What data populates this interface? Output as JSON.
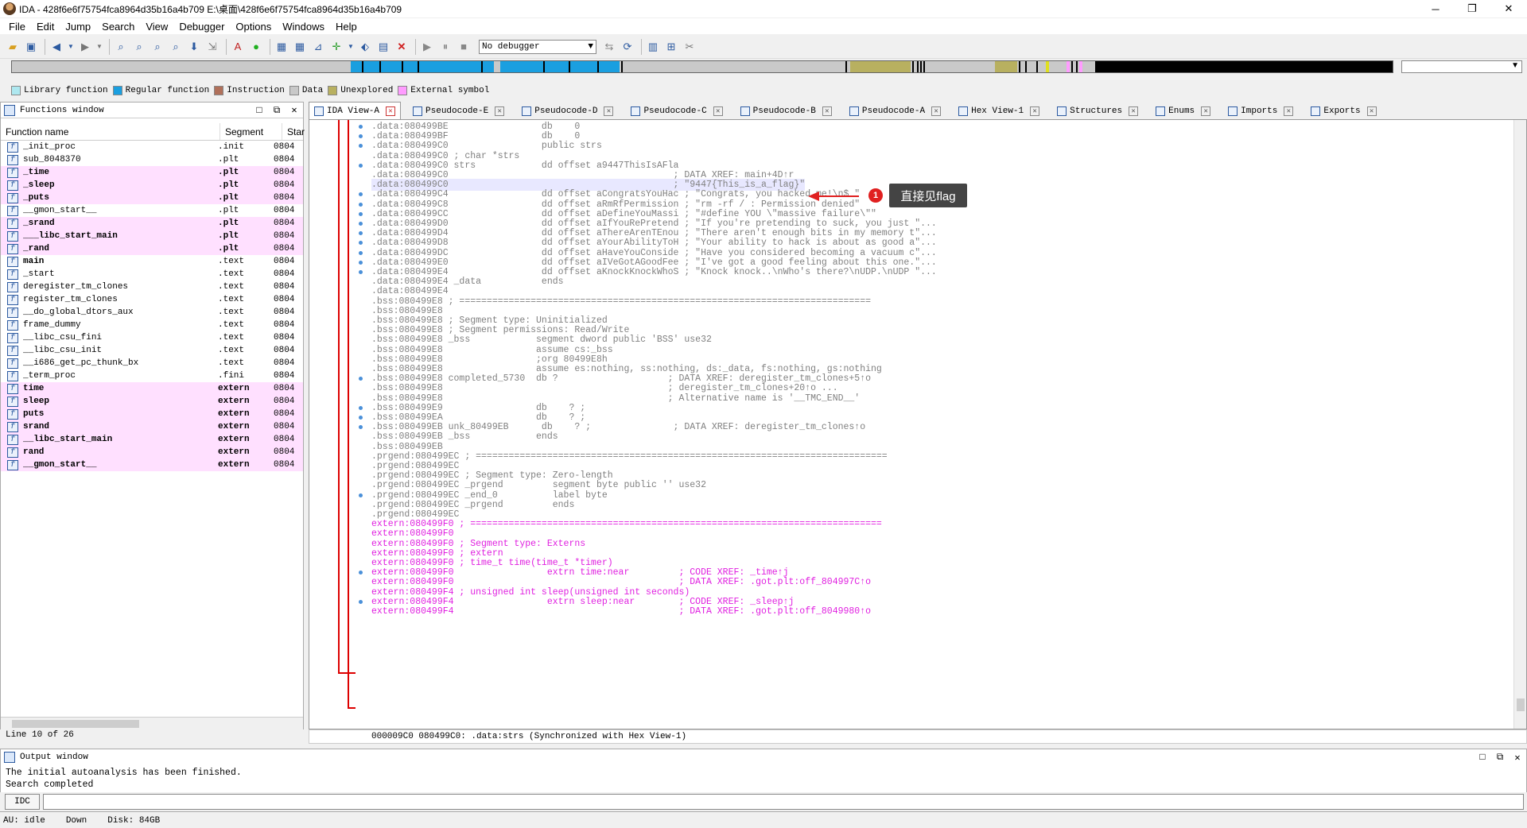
{
  "window": {
    "title": "IDA - 428f6e6f75754fca8964d35b16a4b709 E:\\桌面\\428f6e6f75754fca8964d35b16a4b709"
  },
  "menu": [
    "File",
    "Edit",
    "Jump",
    "Search",
    "View",
    "Debugger",
    "Options",
    "Windows",
    "Help"
  ],
  "toolbar": {
    "debugger_select": "No debugger"
  },
  "legend": [
    {
      "label": "Library function",
      "color": "#aee8f0"
    },
    {
      "label": "Regular function",
      "color": "#1a9fe0"
    },
    {
      "label": "Instruction",
      "color": "#b0705a"
    },
    {
      "label": "Data",
      "color": "#c8c8c8"
    },
    {
      "label": "Unexplored",
      "color": "#b8b060"
    },
    {
      "label": "External symbol",
      "color": "#ff9cff"
    }
  ],
  "functions_window": {
    "title": "Functions window",
    "columns": [
      "Function name",
      "Segment",
      "Star"
    ],
    "rows": [
      {
        "name": "_init_proc",
        "seg": ".init",
        "addr": "0804",
        "hl": false
      },
      {
        "name": "sub_8048370",
        "seg": ".plt",
        "addr": "0804",
        "hl": false
      },
      {
        "name": "_time",
        "seg": ".plt",
        "addr": "0804",
        "hl": true
      },
      {
        "name": "_sleep",
        "seg": ".plt",
        "addr": "0804",
        "hl": true
      },
      {
        "name": "_puts",
        "seg": ".plt",
        "addr": "0804",
        "hl": true
      },
      {
        "name": "__gmon_start__",
        "seg": ".plt",
        "addr": "0804",
        "hl": false
      },
      {
        "name": "_srand",
        "seg": ".plt",
        "addr": "0804",
        "hl": true
      },
      {
        "name": "___libc_start_main",
        "seg": ".plt",
        "addr": "0804",
        "hl": true
      },
      {
        "name": "_rand",
        "seg": ".plt",
        "addr": "0804",
        "hl": true
      },
      {
        "name": "main",
        "seg": ".text",
        "addr": "0804",
        "hl": false,
        "bold": true
      },
      {
        "name": "_start",
        "seg": ".text",
        "addr": "0804",
        "hl": false
      },
      {
        "name": "deregister_tm_clones",
        "seg": ".text",
        "addr": "0804",
        "hl": false
      },
      {
        "name": "register_tm_clones",
        "seg": ".text",
        "addr": "0804",
        "hl": false
      },
      {
        "name": "__do_global_dtors_aux",
        "seg": ".text",
        "addr": "0804",
        "hl": false
      },
      {
        "name": "frame_dummy",
        "seg": ".text",
        "addr": "0804",
        "hl": false
      },
      {
        "name": "__libc_csu_fini",
        "seg": ".text",
        "addr": "0804",
        "hl": false
      },
      {
        "name": "__libc_csu_init",
        "seg": ".text",
        "addr": "0804",
        "hl": false
      },
      {
        "name": "__i686_get_pc_thunk_bx",
        "seg": ".text",
        "addr": "0804",
        "hl": false
      },
      {
        "name": "_term_proc",
        "seg": ".fini",
        "addr": "0804",
        "hl": false
      },
      {
        "name": "time",
        "seg": "extern",
        "addr": "0804",
        "hl": true
      },
      {
        "name": "sleep",
        "seg": "extern",
        "addr": "0804",
        "hl": true
      },
      {
        "name": "puts",
        "seg": "extern",
        "addr": "0804",
        "hl": true
      },
      {
        "name": "srand",
        "seg": "extern",
        "addr": "0804",
        "hl": true
      },
      {
        "name": "__libc_start_main",
        "seg": "extern",
        "addr": "0804",
        "hl": true
      },
      {
        "name": "rand",
        "seg": "extern",
        "addr": "0804",
        "hl": true
      },
      {
        "name": "__gmon_start__",
        "seg": "extern",
        "addr": "0804",
        "hl": true
      }
    ],
    "line_status": "Line 10 of 26"
  },
  "tabs": [
    {
      "label": "IDA View-A",
      "active": true
    },
    {
      "label": "Pseudocode-E",
      "active": false
    },
    {
      "label": "Pseudocode-D",
      "active": false
    },
    {
      "label": "Pseudocode-C",
      "active": false
    },
    {
      "label": "Pseudocode-B",
      "active": false
    },
    {
      "label": "Pseudocode-A",
      "active": false
    },
    {
      "label": "Hex View-1",
      "active": false
    },
    {
      "label": "Structures",
      "active": false
    },
    {
      "label": "Enums",
      "active": false
    },
    {
      "label": "Imports",
      "active": false
    },
    {
      "label": "Exports",
      "active": false
    }
  ],
  "disasm": [
    {
      "t": ".data:080499BE                 db    0",
      "c": "data"
    },
    {
      "t": ".data:080499BF                 db    0",
      "c": "data"
    },
    {
      "t": ".data:080499C0                 public strs",
      "c": "data"
    },
    {
      "t": ".data:080499C0 ; char *strs",
      "c": "data"
    },
    {
      "t": ".data:080499C0 strs            dd offset a9447ThisIsAFla",
      "c": "data"
    },
    {
      "t": ".data:080499C0                                         ; DATA XREF: main+4D↑r",
      "c": "data"
    },
    {
      "t": ".data:080499C0                                         ; \"9447{This_is_a_flag}\"",
      "c": "data",
      "sel": true
    },
    {
      "t": ".data:080499C4                 dd offset aCongratsYouHac ; \"Congrats, you hacked me!\\n$ \"",
      "c": "data"
    },
    {
      "t": ".data:080499C8                 dd offset aRmRfPermission ; \"rm -rf / : Permission denied\"",
      "c": "data"
    },
    {
      "t": ".data:080499CC                 dd offset aDefineYouMassi ; \"#define YOU \\\"massive failure\\\"\"",
      "c": "data"
    },
    {
      "t": ".data:080499D0                 dd offset aIfYouRePretend ; \"If you're pretending to suck, you just \"...",
      "c": "data"
    },
    {
      "t": ".data:080499D4                 dd offset aThereArenTEnou ; \"There aren't enough bits in my memory t\"...",
      "c": "data"
    },
    {
      "t": ".data:080499D8                 dd offset aYourAbilityToH ; \"Your ability to hack is about as good a\"...",
      "c": "data"
    },
    {
      "t": ".data:080499DC                 dd offset aHaveYouConside ; \"Have you considered becoming a vacuum c\"...",
      "c": "data"
    },
    {
      "t": ".data:080499E0                 dd offset aIVeGotAGoodFee ; \"I've got a good feeling about this one.\"...",
      "c": "data"
    },
    {
      "t": ".data:080499E4                 dd offset aKnockKnockWhoS ; \"Knock knock..\\nWho's there?\\nUDP.\\nUDP \"...",
      "c": "data"
    },
    {
      "t": ".data:080499E4 _data           ends",
      "c": "data"
    },
    {
      "t": ".data:080499E4",
      "c": "data"
    },
    {
      "t": ".bss:080499E8 ; ===========================================================================",
      "c": "bss"
    },
    {
      "t": ".bss:080499E8",
      "c": "bss"
    },
    {
      "t": ".bss:080499E8 ; Segment type: Uninitialized",
      "c": "bss"
    },
    {
      "t": ".bss:080499E8 ; Segment permissions: Read/Write",
      "c": "bss"
    },
    {
      "t": ".bss:080499E8 _bss            segment dword public 'BSS' use32",
      "c": "bss"
    },
    {
      "t": ".bss:080499E8                 assume cs:_bss",
      "c": "bss"
    },
    {
      "t": ".bss:080499E8                 ;org 80499E8h",
      "c": "bss"
    },
    {
      "t": ".bss:080499E8                 assume es:nothing, ss:nothing, ds:_data, fs:nothing, gs:nothing",
      "c": "bss"
    },
    {
      "t": ".bss:080499E8 completed_5730  db ?                    ; DATA XREF: deregister_tm_clones+5↑o",
      "c": "bss"
    },
    {
      "t": ".bss:080499E8                                         ; deregister_tm_clones+20↑o ...",
      "c": "bss"
    },
    {
      "t": ".bss:080499E8                                         ; Alternative name is '__TMC_END__'",
      "c": "bss"
    },
    {
      "t": ".bss:080499E9                 db    ? ;",
      "c": "bss"
    },
    {
      "t": ".bss:080499EA                 db    ? ;",
      "c": "bss"
    },
    {
      "t": ".bss:080499EB unk_80499EB      db    ? ;               ; DATA XREF: deregister_tm_clones↑o",
      "c": "bss"
    },
    {
      "t": ".bss:080499EB _bss            ends",
      "c": "bss"
    },
    {
      "t": ".bss:080499EB",
      "c": "bss"
    },
    {
      "t": ".prgend:080499EC ; ===========================================================================",
      "c": "prg"
    },
    {
      "t": ".prgend:080499EC",
      "c": "prg"
    },
    {
      "t": ".prgend:080499EC ; Segment type: Zero-length",
      "c": "prg"
    },
    {
      "t": ".prgend:080499EC _prgend         segment byte public '' use32",
      "c": "prg"
    },
    {
      "t": ".prgend:080499EC _end_0          label byte",
      "c": "prg"
    },
    {
      "t": ".prgend:080499EC _prgend         ends",
      "c": "prg"
    },
    {
      "t": ".prgend:080499EC",
      "c": "prg"
    },
    {
      "t": "extern:080499F0 ; ===========================================================================",
      "c": "ext"
    },
    {
      "t": "extern:080499F0",
      "c": "ext"
    },
    {
      "t": "extern:080499F0 ; Segment type: Externs",
      "c": "ext"
    },
    {
      "t": "extern:080499F0 ; extern",
      "c": "ext"
    },
    {
      "t": "extern:080499F0 ; time_t time(time_t *timer)",
      "c": "ext"
    },
    {
      "t": "extern:080499F0                 extrn time:near         ; CODE XREF: _time↑j",
      "c": "ext"
    },
    {
      "t": "extern:080499F0                                         ; DATA XREF: .got.plt:off_804997C↑o",
      "c": "ext"
    },
    {
      "t": "extern:080499F4 ; unsigned int sleep(unsigned int seconds)",
      "c": "ext"
    },
    {
      "t": "extern:080499F4                 extrn sleep:near        ; CODE XREF: _sleep↑j",
      "c": "ext"
    },
    {
      "t": "extern:080499F4                                         ; DATA XREF: .got.plt:off_8049980↑o",
      "c": "ext"
    }
  ],
  "disasm_status": "000009C0 080499C0: .data:strs (Synchronized with Hex View-1)",
  "annotation": {
    "badge": "1",
    "text": "直接见flag"
  },
  "output_window": {
    "title": "Output window",
    "lines": [
      "The initial autoanalysis has been finished.",
      "Search completed"
    ]
  },
  "idc_button": "IDC",
  "statusbar": {
    "au": "AU:  idle",
    "dir": "Down",
    "disk": "Disk: 84GB"
  }
}
